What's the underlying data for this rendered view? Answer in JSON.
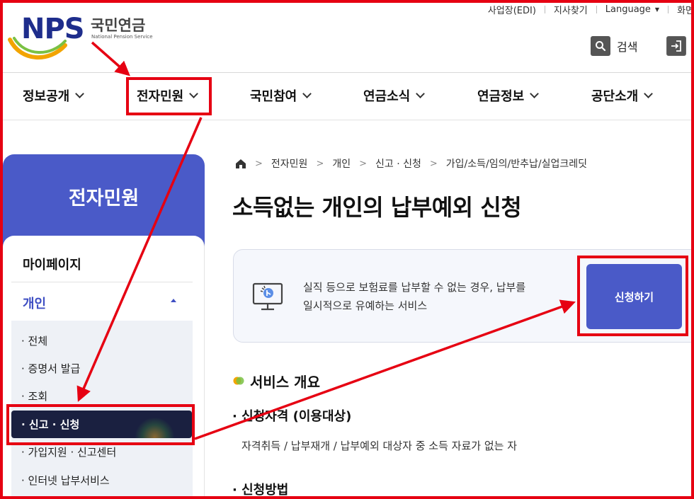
{
  "header": {
    "logo_text": "NPS",
    "logo_ko": "국민연금",
    "logo_en": "National Pension Service",
    "util_links": [
      "사업장(EDI)",
      "지사찾기",
      "Language",
      "화면"
    ],
    "search_label": "검색"
  },
  "gnb": {
    "items": [
      "정보공개",
      "전자민원",
      "국민참여",
      "연금소식",
      "연금정보",
      "공단소개"
    ]
  },
  "sidebar": {
    "title": "전자민원",
    "mypage": "마이페이지",
    "section": "개인",
    "sub_items": [
      "· 전체",
      "· 증명서 발급",
      "· 조회",
      "· 신고 · 신청",
      "· 가입지원 · 신고센터",
      "· 인터넷 납부서비스"
    ]
  },
  "breadcrumb": [
    "전자민원",
    "개인",
    "신고 · 신청",
    "가입/소득/임의/반추납/실업크레딧"
  ],
  "main": {
    "title": "소득없는 개인의 납부예외 신청",
    "desc_line1": "실직 등으로 보험료를 납부할 수 없는 경우, 납부를",
    "desc_line2": "일시적으로 유예하는 서비스",
    "apply_label": "신청하기",
    "section_title": "서비스 개요",
    "qual_heading": "· 신청자격 (이용대상)",
    "qual_text": "자격취득 / 납부재개 / 납부예외 대상자 중 소득 자료가 없는 자",
    "method_heading": "· 신청방법"
  },
  "colors": {
    "brand_blue": "#4a5ac8",
    "highlight_red": "#e60012",
    "active_nav": "#1a2040"
  }
}
